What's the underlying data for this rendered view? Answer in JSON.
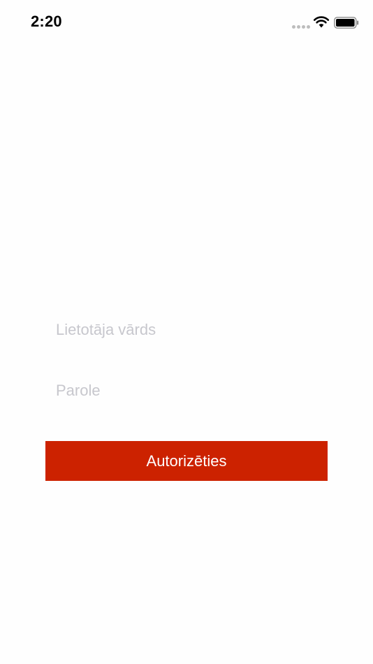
{
  "status_bar": {
    "time": "2:20",
    "signal_icon": "signal-dots-icon",
    "wifi_icon": "wifi-icon",
    "battery_icon": "battery-icon"
  },
  "login_form": {
    "username": {
      "value": "",
      "placeholder": "Lietotāja vārds"
    },
    "password": {
      "value": "",
      "placeholder": "Parole"
    },
    "submit_label": "Autorizēties"
  },
  "colors": {
    "background": "#fefefe",
    "accent": "#cc2200",
    "button_text": "#ffffff",
    "placeholder": "#c7c7cd"
  }
}
